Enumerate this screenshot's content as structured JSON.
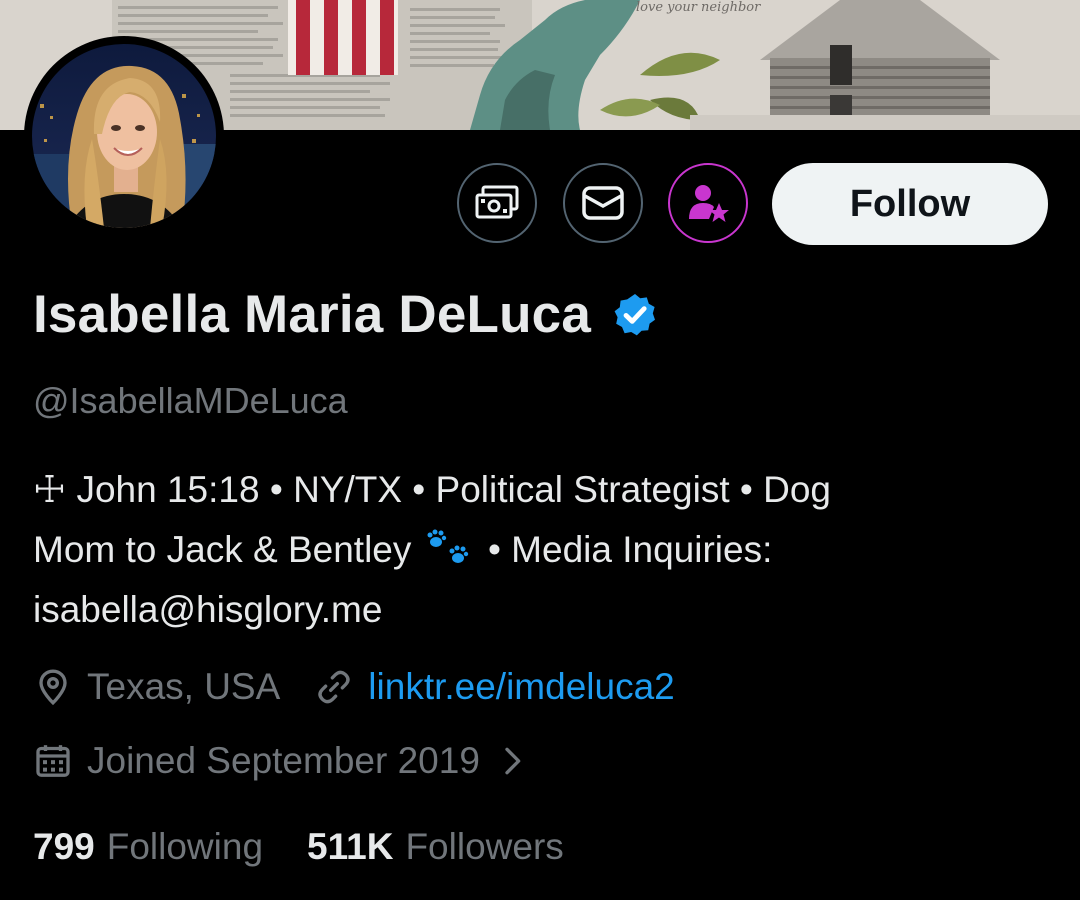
{
  "banner": {
    "script_text": "love your neighbor"
  },
  "profile": {
    "display_name": "Isabella Maria DeLuca",
    "handle": "@IsabellaMDeLuca",
    "bio": {
      "line1": "☩ John 15:18 • NY/TX • Political Strategist • Dog",
      "line2_pre": "Mom to Jack & Bentley",
      "line2_post": "• Media Inquiries:",
      "line3": "isabella@hisglory.me"
    },
    "location": "Texas, USA",
    "website": "linktr.ee/imdeluca2",
    "joined": "Joined September 2019"
  },
  "stats": {
    "following_count": "799",
    "following_label": "Following",
    "followers_count": "511K",
    "followers_label": "Followers"
  },
  "actions": {
    "follow_label": "Follow"
  },
  "icons": {
    "tip": "money-icon",
    "message": "envelope-icon",
    "subscribe": "person-star-icon",
    "verified": "verified-badge-icon",
    "location": "location-pin-icon",
    "link": "link-icon",
    "calendar": "calendar-icon",
    "chevron": "chevron-right-icon"
  },
  "colors": {
    "background": "#000000",
    "text_primary": "#e7e9ea",
    "text_secondary": "#71767b",
    "link": "#1d9bf0",
    "verified": "#1d9bf0",
    "subscribe_accent": "#c936cf",
    "follow_button_bg": "#eff3f4"
  }
}
